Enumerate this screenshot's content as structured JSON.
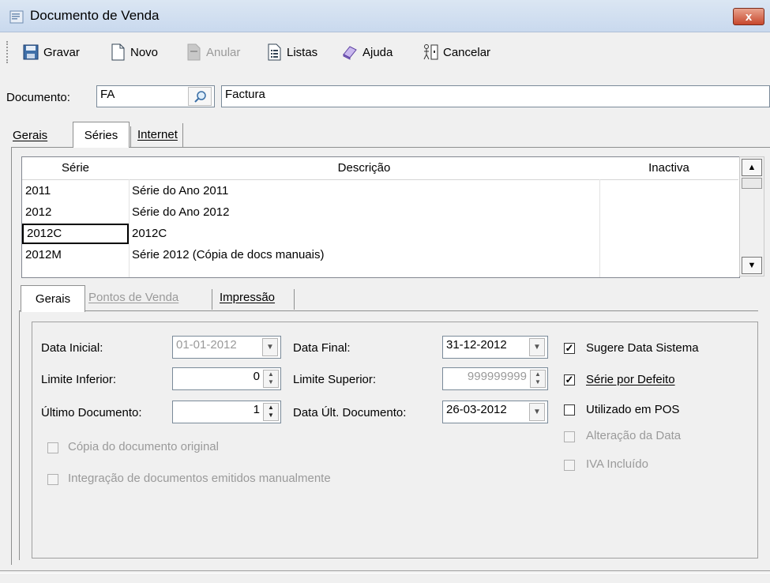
{
  "window": {
    "title": "Documento de Venda",
    "close": "x"
  },
  "toolbar": {
    "gravar": "Gravar",
    "novo": "Novo",
    "anular": "Anular",
    "listas": "Listas",
    "ajuda": "Ajuda",
    "cancelar": "Cancelar"
  },
  "document": {
    "label": "Documento:",
    "code": "FA",
    "description": "Factura"
  },
  "tabs": [
    "Gerais",
    "Séries",
    "Internet"
  ],
  "series_grid": {
    "headers": [
      "Série",
      "Descrição",
      "Inactiva"
    ],
    "rows": [
      [
        "2011",
        "Série do Ano 2011",
        ""
      ],
      [
        "2012",
        "Série do Ano 2012",
        ""
      ],
      [
        "2012C",
        "2012C",
        ""
      ],
      [
        "2012M",
        "Série 2012 (Cópia de docs manuais)",
        ""
      ]
    ]
  },
  "subtabs": [
    "Gerais",
    "Pontos de Venda",
    "Impressão"
  ],
  "form": {
    "data_inicial_label": "Data Inicial:",
    "data_inicial": "01-01-2012",
    "data_final_label": "Data Final:",
    "data_final": "31-12-2012",
    "limite_inferior_label": "Limite Inferior:",
    "limite_inferior": "0",
    "limite_superior_label": "Limite Superior:",
    "limite_superior": "999999999",
    "ultimo_documento_label": "Último Documento:",
    "ultimo_documento": "1",
    "data_ult_documento_label": "Data Últ. Documento:",
    "data_ult_documento": "26-03-2012",
    "sugere_data_sistema": "Sugere Data Sistema",
    "serie_por_defeito": "Série por Defeito",
    "utilizado_em_pos": "Utilizado em POS",
    "alteracao_da_data": "Alteração da Data",
    "iva_incluido": "IVA Incluído",
    "copia_documento_original": "Cópia do documento original",
    "integracao_documentos": "Integração de documentos emitidos manualmente"
  }
}
